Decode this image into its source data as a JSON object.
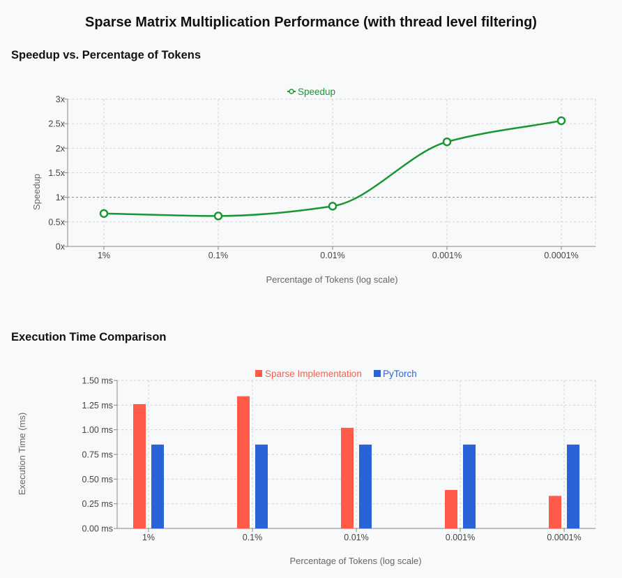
{
  "title": "Sparse Matrix Multiplication Performance (with thread level filtering)",
  "colors": {
    "speedup": "#1a9632",
    "sparse": "#ff5b48",
    "pytorch": "#2a63d8"
  },
  "chart_data": [
    {
      "type": "line",
      "title": "Speedup vs. Percentage of Tokens",
      "xlabel": "Percentage of Tokens (log scale)",
      "ylabel": "Speedup",
      "categories": [
        "1%",
        "0.1%",
        "0.01%",
        "0.001%",
        "0.0001%"
      ],
      "yticks": [
        "0x",
        "0.5x",
        "1x",
        "1.5x",
        "2x",
        "2.5x",
        "3x"
      ],
      "ylim": [
        0,
        3
      ],
      "reference_line": 1,
      "grid": true,
      "legend_position": "top-center",
      "series": [
        {
          "name": "Speedup",
          "values": [
            0.67,
            0.62,
            0.82,
            2.13,
            2.56
          ]
        }
      ]
    },
    {
      "type": "bar",
      "title": "Execution Time Comparison",
      "xlabel": "Percentage of Tokens (log scale)",
      "ylabel": "Execution Time (ms)",
      "categories": [
        "1%",
        "0.1%",
        "0.01%",
        "0.001%",
        "0.0001%"
      ],
      "yticks": [
        "0.00 ms",
        "0.25 ms",
        "0.50 ms",
        "0.75 ms",
        "1.00 ms",
        "1.25 ms",
        "1.50 ms"
      ],
      "ylim": [
        0,
        1.5
      ],
      "grid": true,
      "legend_position": "top-center",
      "series": [
        {
          "name": "Sparse Implementation",
          "values": [
            1.26,
            1.34,
            1.02,
            0.39,
            0.33
          ]
        },
        {
          "name": "PyTorch",
          "values": [
            0.85,
            0.85,
            0.85,
            0.85,
            0.85
          ]
        }
      ]
    }
  ]
}
